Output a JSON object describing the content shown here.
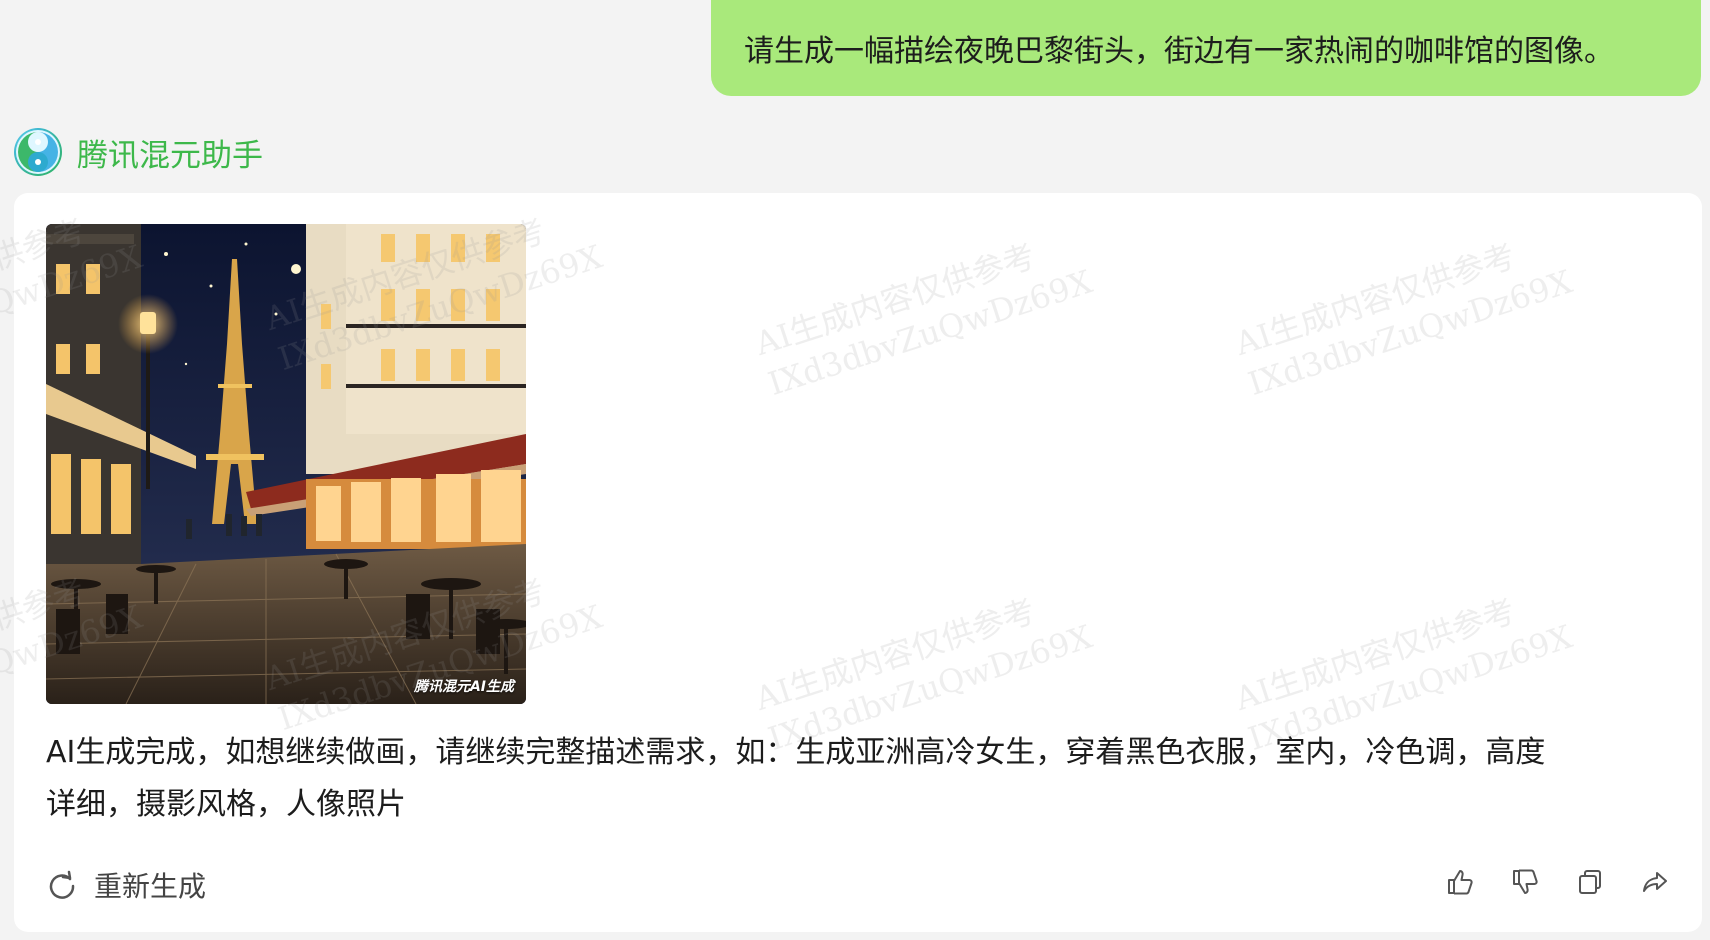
{
  "conversation": {
    "user_message": "请生成一幅描绘夜晚巴黎街头，街边有一家热闹的咖啡馆的图像。",
    "assistant": {
      "name": "腾讯混元助手",
      "image_watermark": "腾讯混元AI生成",
      "reply_line1": "AI生成完成，如想继续做画，请继续完整描述需求，如：生成亚洲高冷女生，穿着黑色衣服，室内，冷色调，高度",
      "reply_line2": "详细，摄影风格，人像照片",
      "regenerate_label": "重新生成"
    }
  },
  "watermark": {
    "line1": "AI生成内容仅供参考",
    "line2": "IXd3dbvZuQwDz69X"
  },
  "icons": {
    "avatar": "hunyuan-logo-icon",
    "regenerate": "refresh-icon",
    "like": "thumbs-up-icon",
    "dislike": "thumbs-down-icon",
    "copy": "copy-icon",
    "share": "share-icon"
  },
  "colors": {
    "page_background": "#f3f3f3",
    "user_bubble": "#a9e97b",
    "assistant_name": "#3db84a",
    "card_background": "#ffffff"
  }
}
